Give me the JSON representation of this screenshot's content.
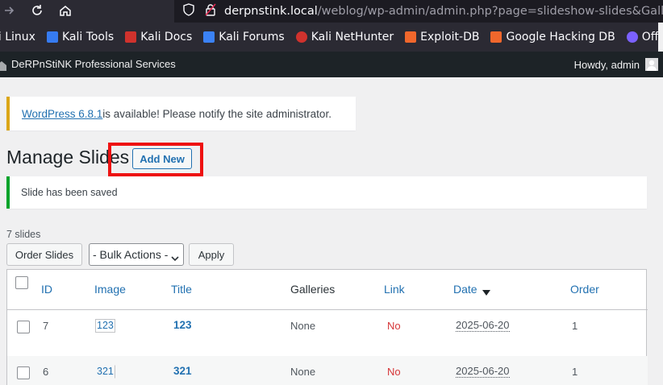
{
  "browser": {
    "url_host": "derpnstink.local",
    "url_path": "/weblog/wp-admin/admin.php?page=slideshow-slides&Gallery",
    "bookmarks": [
      {
        "label": "li Linux",
        "icon": "kali-linux-icon",
        "color": "#367bf0"
      },
      {
        "label": "Kali Tools",
        "icon": "kali-tools-icon",
        "color": "#e94545"
      },
      {
        "label": "Kali Docs",
        "icon": "kali-docs-icon",
        "color": "#d0322d"
      },
      {
        "label": "Kali Forums",
        "icon": "kali-forums-icon",
        "color": "#3b82f6"
      },
      {
        "label": "Kali NetHunter",
        "icon": "nethunter-icon",
        "color": "#d0322d"
      },
      {
        "label": "Exploit-DB",
        "icon": "exploit-db-icon",
        "color": "#f0672c"
      },
      {
        "label": "Google Hacking DB",
        "icon": "ghdb-icon",
        "color": "#f0672c"
      },
      {
        "label": "OffSec",
        "icon": "offsec-icon",
        "color": "#7b61ff"
      }
    ]
  },
  "adminbar": {
    "site_name": "DeRPnStiNK Professional Services",
    "howdy": "Howdy, admin"
  },
  "update_notice": {
    "link": "WordPress 6.8.1",
    "text": " is available! Please notify the site administrator."
  },
  "page": {
    "title": "Manage Slides",
    "add_new": "Add New",
    "saved_notice": "Slide has been saved",
    "count": "7 slides",
    "order_slides": "Order Slides",
    "bulk_actions": "- Bulk Actions -",
    "apply": "Apply"
  },
  "table": {
    "columns": {
      "id": "ID",
      "image": "Image",
      "title": "Title",
      "galleries": "Galleries",
      "link": "Link",
      "date": "Date",
      "order": "Order"
    },
    "rows": [
      {
        "id": "7",
        "image": "123",
        "title": "123",
        "galleries": "None",
        "link": "No",
        "date": "2025-06-20",
        "order": "1"
      },
      {
        "id": "6",
        "image": "321",
        "title": "321",
        "galleries": "None",
        "link": "No",
        "date": "2025-06-20",
        "order": "1"
      }
    ]
  },
  "colors": {
    "accent": "#2271b1",
    "highlight": "#ee1111",
    "success": "#00a32a",
    "warning": "#dba617",
    "error": "#d63638"
  }
}
